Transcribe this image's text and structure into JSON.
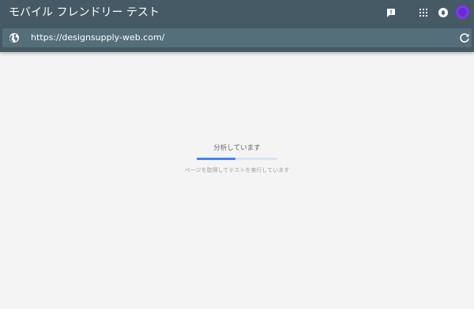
{
  "app": {
    "title": "モバイル フレンドリー テスト"
  },
  "header_icons": {
    "feedback": "feedback-icon",
    "apps": "apps-grid-icon",
    "notifications": "notifications-icon",
    "avatar": "account-avatar"
  },
  "urlbar": {
    "url": "https://designsupply-web.com/",
    "left_icon": "globe-icon",
    "right_icon": "reload-icon"
  },
  "status": {
    "title": "分析しています",
    "subtitle": "ページを取得してテストを実行しています",
    "progress_fraction": 0.48
  },
  "colors": {
    "header": "#455a64",
    "urlbar": "#546e7a",
    "background": "#f4f4f4",
    "progress": "#4285f4",
    "progress_track": "#d6e4f5",
    "avatar": "#6d28d9"
  }
}
